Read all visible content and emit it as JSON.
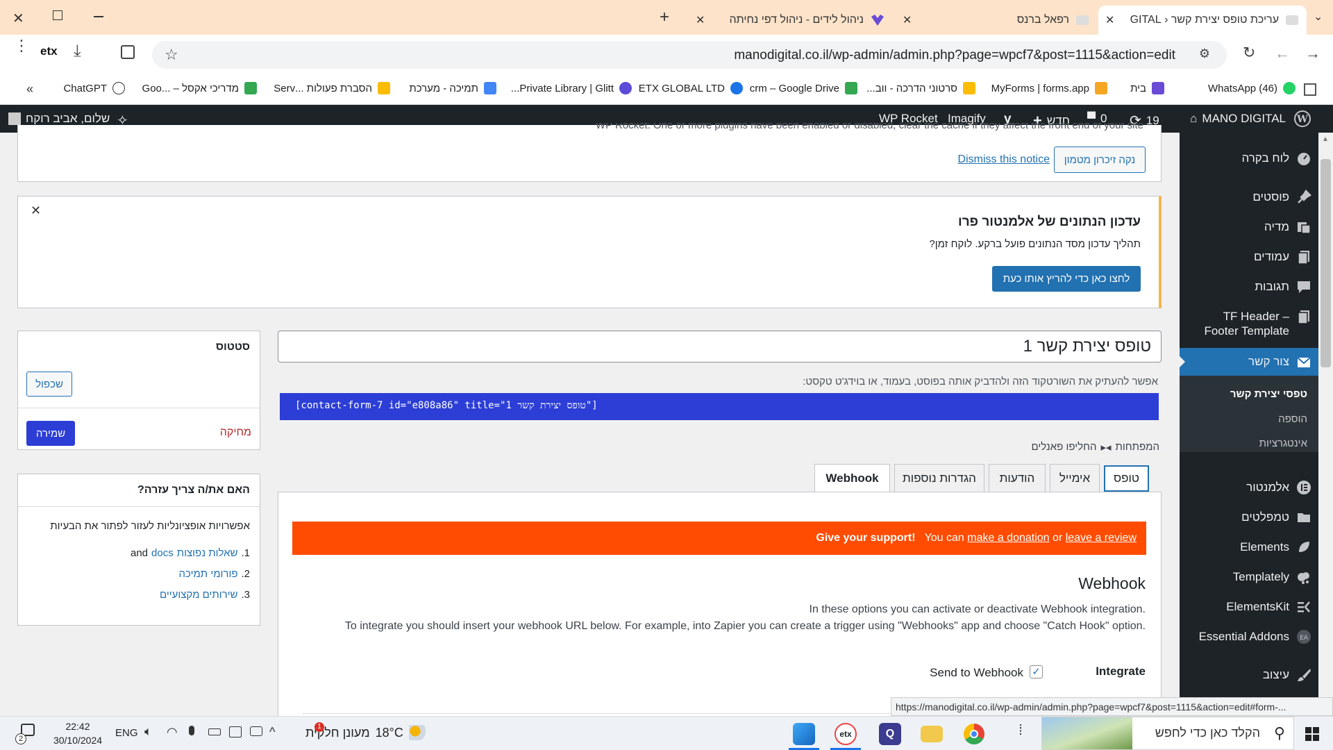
{
  "browser": {
    "tabs": [
      {
        "title": "עריכת טופס יצירת קשר ‹ GITAL",
        "active": true
      },
      {
        "title": "רפאל ברנס",
        "active": false
      },
      {
        "title": "ניהול לידים - ניהול דפי נחיתה",
        "active": false
      }
    ],
    "url": "manodigital.co.il/wp-admin/admin.php?page=wpcf7&post=1115&action=edit",
    "bookmarks": [
      "(46) WhatsApp",
      "בית",
      "MyForms | forms.app",
      "סרטוני הדרכה - ווב...",
      "crm – Google Drive",
      "ETX GLOBAL LTD",
      "Private Library | Glitt...",
      "תמיכה - מערכת",
      "הסברת פעולות ...Serv",
      "מדריכי אקסל – ...Goo",
      "ChatGPT"
    ],
    "status_url": "https://manodigital.co.il/wp-admin/admin.php?page=wpcf7&post=1115&action=edit#form-..."
  },
  "adminbar": {
    "site": "MANO DIGITAL",
    "updates": "19",
    "comments": "0",
    "new": "חדש",
    "imagify": "Imagify",
    "wprocket": "WP Rocket",
    "greeting": "שלום, אביב רוקח"
  },
  "sidebar": {
    "items": [
      {
        "label": "לוח בקרה",
        "icon": "dashboard-icon"
      },
      {
        "label": "פוסטים",
        "icon": "pin-icon"
      },
      {
        "label": "מדיה",
        "icon": "media-icon"
      },
      {
        "label": "עמודים",
        "icon": "pages-icon"
      },
      {
        "label": "תגובות",
        "icon": "comment-icon"
      },
      {
        "label": "TF Header – Footer Template",
        "icon": "pages-icon"
      },
      {
        "label": "צור קשר",
        "icon": "mail-icon"
      },
      {
        "label": "אלמנטור",
        "icon": "elementor-icon"
      },
      {
        "label": "טמפלטים",
        "icon": "folder-icon"
      },
      {
        "label": "Elements",
        "icon": "leaf-icon"
      },
      {
        "label": "Templately",
        "icon": "cloud-icon"
      },
      {
        "label": "ElementsKit",
        "icon": "ek-icon"
      },
      {
        "label": "Essential Addons",
        "icon": "ea-icon"
      },
      {
        "label": "עיצוב",
        "icon": "brush-icon"
      }
    ],
    "submenu": [
      "טפסי יצירת קשר",
      "הוספה",
      "אינטגרציות"
    ]
  },
  "notice_top": {
    "text": "WP Rocket: One or more plugins have been enabled or disabled, clear the cache if they affect the front end of your site",
    "clear_button": "נקה זיכרון מטמון",
    "dismiss": "Dismiss this notice"
  },
  "elementor_notice": {
    "title": "עדכון הנתונים של אלמנטור פרו",
    "text": "תהליך עדכון מסד הנתונים פועל ברקע. לוקח זמן?",
    "button": "לחצו כאן כדי להריץ אותו כעת"
  },
  "form": {
    "title": "טופס יצירת קשר 1",
    "shortcode_hint": "אפשר להעתיק את השורטקוד הזה ולהדביק אותה בפוסט, בעמוד, או בוידג'ט טקסט:",
    "shortcode": "[contact-form-7 id=\"e808a86\" title=\"טופס יצירת קשר 1\"]",
    "keys_label": "המפתחות",
    "switch_panels": "החליפו פאנלים",
    "tabs": [
      "טופס",
      "אימייל",
      "הודעות",
      "הגדרות נוספות",
      "Webhook"
    ]
  },
  "webhook": {
    "support_strong": "Give your support!",
    "support_you_can": "You can",
    "support_donation": "make a donation",
    "support_or": "or",
    "support_review": "leave a review",
    "title": "Webhook",
    "desc1": "In these options you can activate or deactivate Webhook integration.",
    "desc2": "To integrate you should insert your webhook URL below. For example, into Zapier you can create a trigger using \"Webhooks\" app and choose \"Catch Hook\" option.",
    "integrate_label": "Integrate",
    "send_label": "Send to Webhook",
    "send_checked": true
  },
  "status_box": {
    "title": "סטטוס",
    "duplicate": "שכפול",
    "delete": "מחיקה",
    "save": "שמירה"
  },
  "help_box": {
    "title": "האם את/ה צריך עזרה?",
    "intro": "אפשרויות אופציונליות לעזור לפתור את הבעיות",
    "items": [
      {
        "num": "1.",
        "link": "שאלות נפוצות",
        "and": "and",
        "docs": "docs"
      },
      {
        "num": "2.",
        "link": "פורומי תמיכה"
      },
      {
        "num": "3.",
        "link": "שירותים מקצועיים"
      }
    ]
  },
  "taskbar": {
    "search": "הקלד כאן כדי לחפש",
    "weather_temp": "18°C",
    "weather_text": "מעונן חלקית",
    "lang": "ENG",
    "time": "22:42",
    "date": "30/10/2024",
    "notif_count": "2",
    "weather_badge": "1"
  },
  "colors": {
    "accent": "#2271b1",
    "menu_active": "#2271b1",
    "orange": "#ff4c00",
    "shortcode_bg": "#2c3ed6"
  }
}
